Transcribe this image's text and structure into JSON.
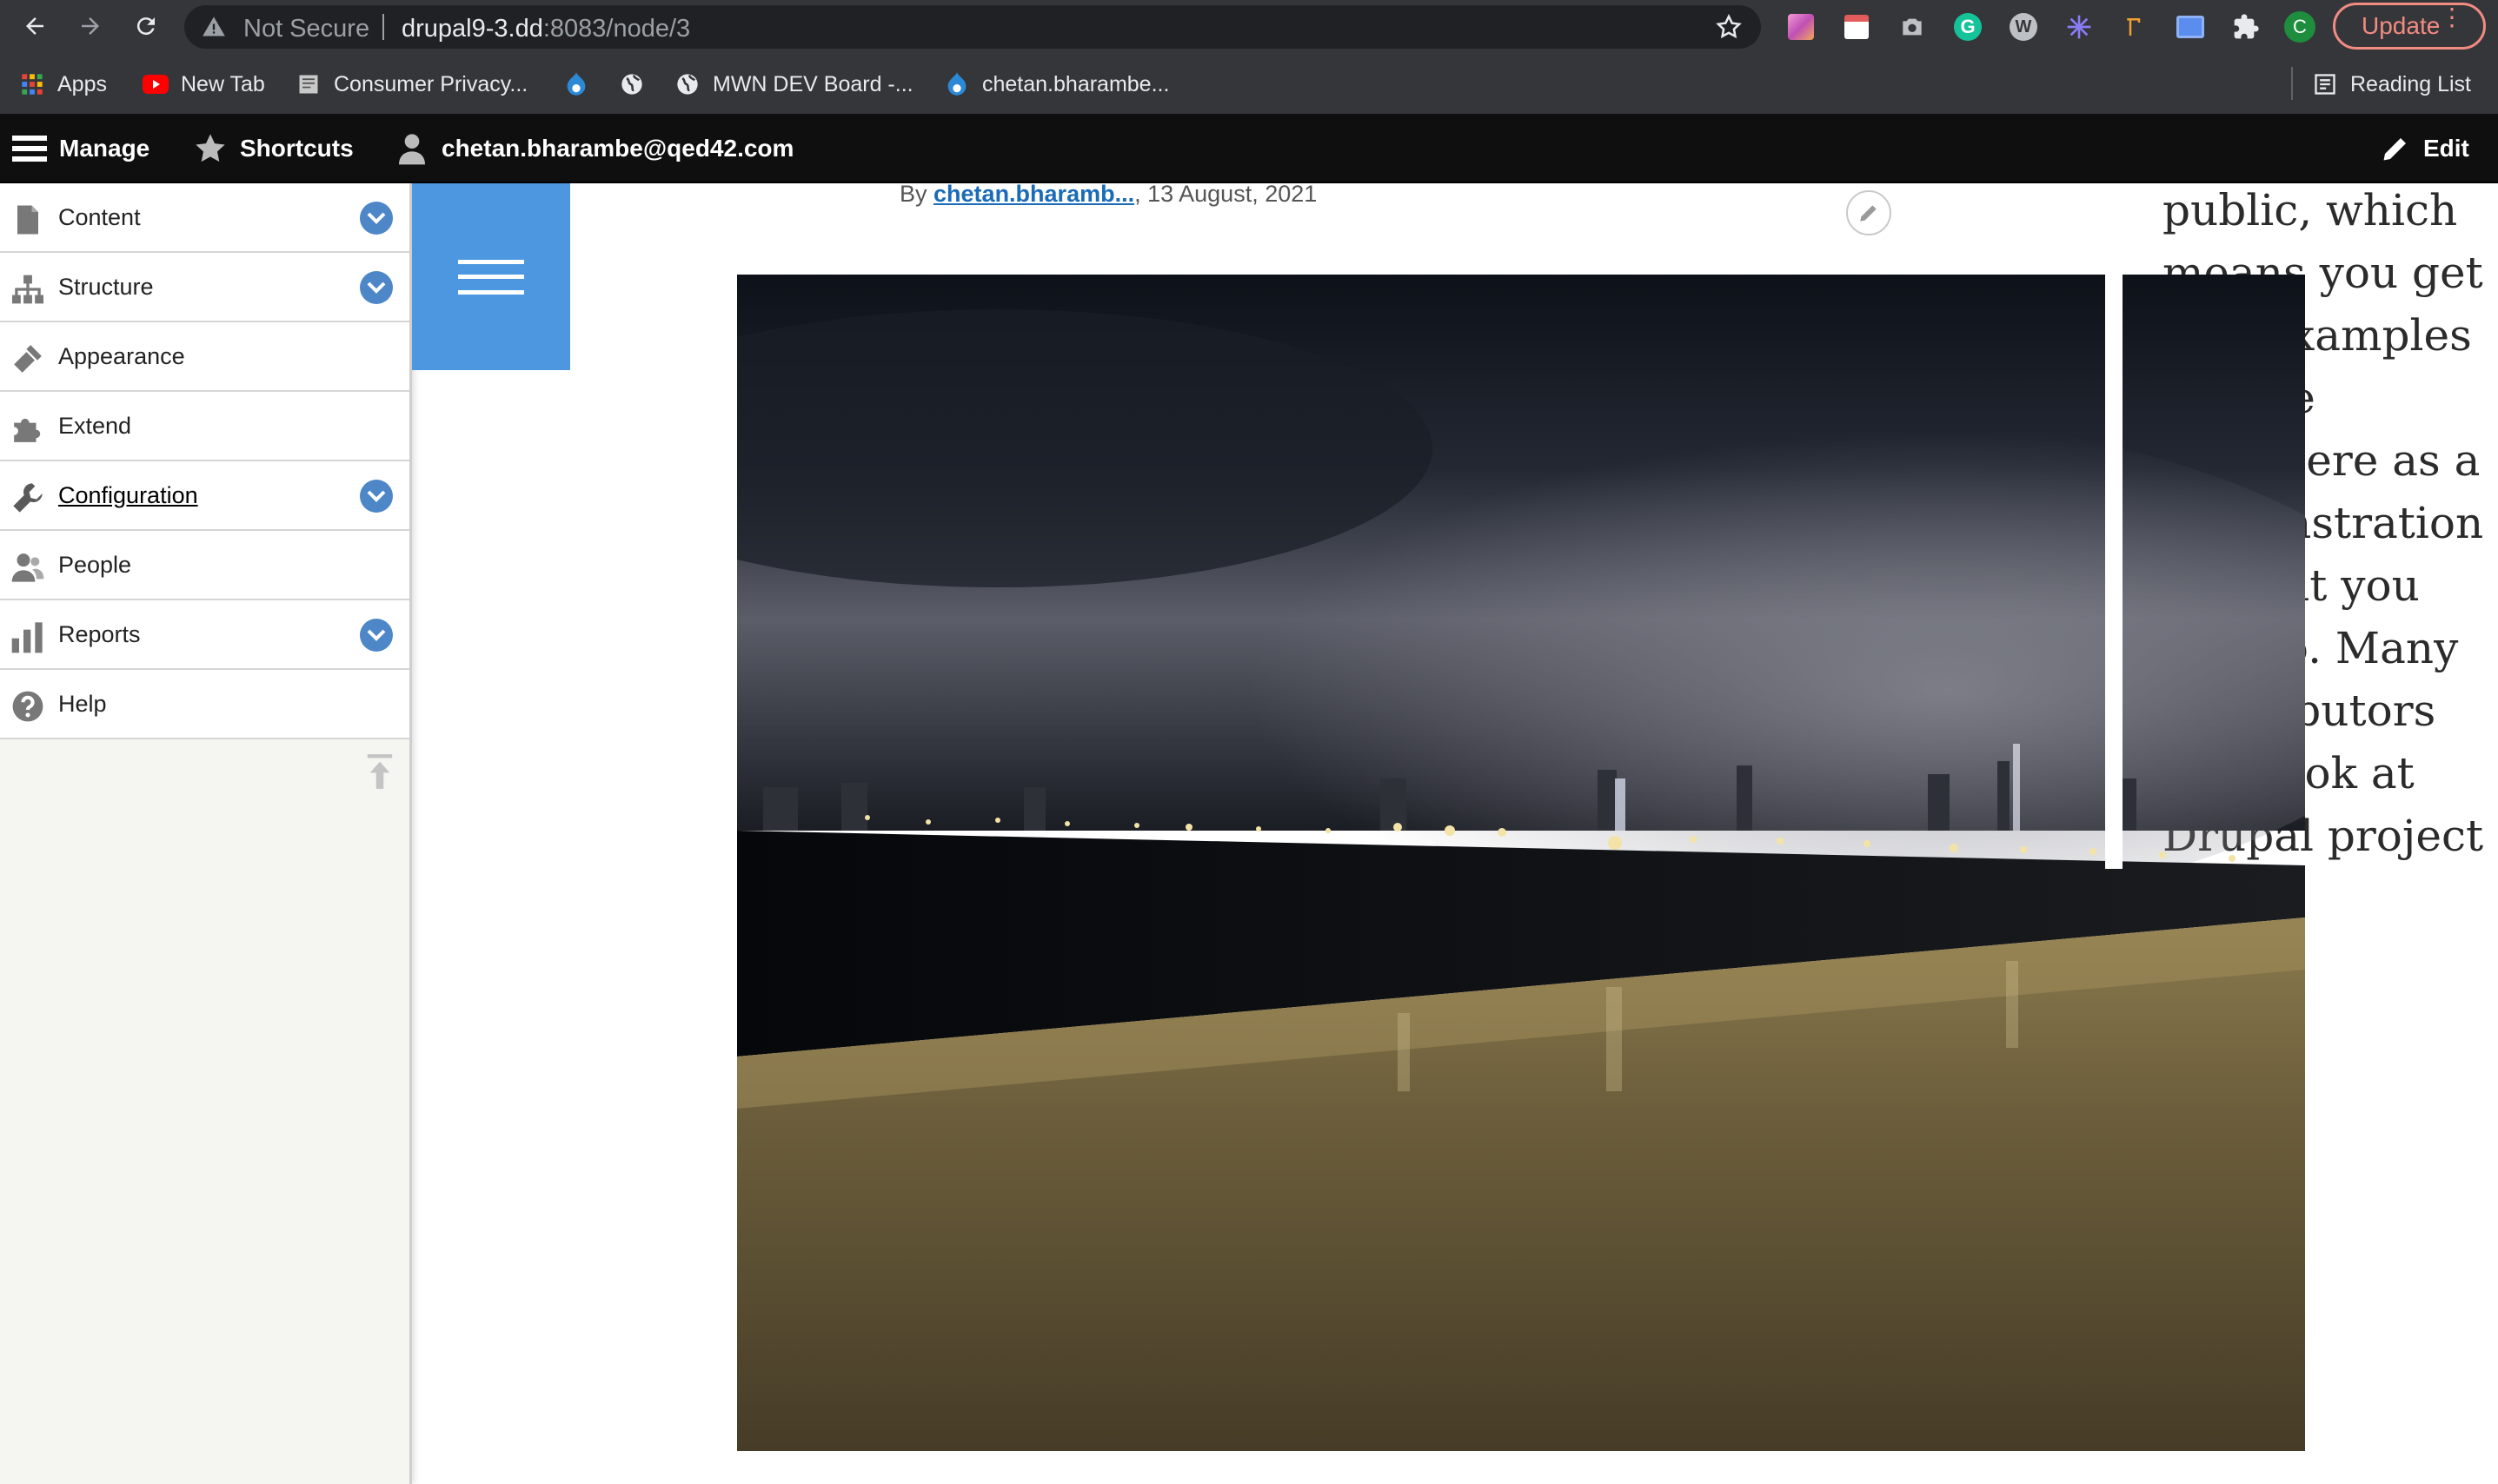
{
  "browser": {
    "security_label": "Not Secure",
    "url_host": "drupal9-3.dd",
    "url_path": ":8083/node/3",
    "update_label": "Update",
    "profile_initial": "C",
    "reading_list_label": "Reading List",
    "bookmarks": [
      {
        "label": "Apps",
        "icon": "apps-grid-icon"
      },
      {
        "label": "New Tab",
        "icon": "youtube-icon"
      },
      {
        "label": "Consumer Privacy...",
        "icon": "document-icon"
      },
      {
        "label": "",
        "icon": "drupal-icon"
      },
      {
        "label": "",
        "icon": "globe-icon"
      },
      {
        "label": "MWN DEV Board -...",
        "icon": "globe-icon"
      },
      {
        "label": "chetan.bharambe...",
        "icon": "drupal-icon"
      }
    ]
  },
  "toolbar": {
    "manage_label": "Manage",
    "shortcuts_label": "Shortcuts",
    "user_label": "chetan.bharambe@qed42.com",
    "edit_label": "Edit"
  },
  "admin_menu": {
    "items": [
      {
        "label": "Content",
        "icon": "content-icon",
        "expandable": true
      },
      {
        "label": "Structure",
        "icon": "structure-icon",
        "expandable": true
      },
      {
        "label": "Appearance",
        "icon": "appearance-icon",
        "expandable": false
      },
      {
        "label": "Extend",
        "icon": "extend-icon",
        "expandable": false
      },
      {
        "label": "Configuration",
        "icon": "configuration-icon",
        "expandable": true,
        "active": true
      },
      {
        "label": "People",
        "icon": "people-icon",
        "expandable": false
      },
      {
        "label": "Reports",
        "icon": "reports-icon",
        "expandable": true
      },
      {
        "label": "Help",
        "icon": "help-icon",
        "expandable": false
      }
    ]
  },
  "article": {
    "by_prefix": "By",
    "author": "chetan.bharamb...",
    "date": ", 13 August, 2021"
  },
  "sidebar_text_lines": [
    "public, which",
    "means you get",
    "free examples",
    "to take",
    "anywhere as a",
    "demonstration",
    "of what you",
    "can do. Many",
    "contributors",
    "also look at",
    "Drupal project"
  ],
  "colors": {
    "chrome_bg": "#35363a",
    "toolbar_bg": "#0f0f0f",
    "accent_blue": "#4c97e0",
    "chevron_blue": "#4d87c7",
    "link_blue": "#1a6bb8",
    "update_red": "#f28b82"
  }
}
